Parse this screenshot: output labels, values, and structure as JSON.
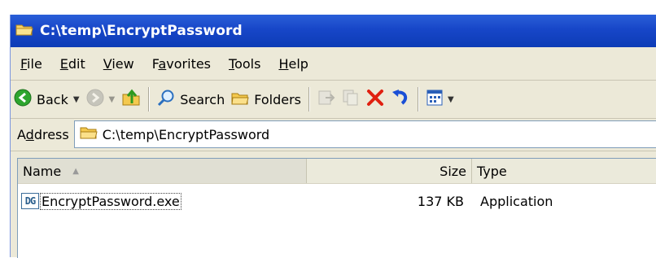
{
  "window": {
    "title": "C:\\temp\\EncryptPassword"
  },
  "menubar": {
    "items": [
      {
        "pre": "",
        "u": "F",
        "post": "ile"
      },
      {
        "pre": "",
        "u": "E",
        "post": "dit"
      },
      {
        "pre": "",
        "u": "V",
        "post": "iew"
      },
      {
        "pre": "F",
        "u": "a",
        "post": "vorites"
      },
      {
        "pre": "",
        "u": "T",
        "post": "ools"
      },
      {
        "pre": "",
        "u": "H",
        "post": "elp"
      }
    ]
  },
  "toolbar": {
    "back_label": "Back",
    "search_label": "Search",
    "folders_label": "Folders"
  },
  "address": {
    "label_pre": "A",
    "label_u": "d",
    "label_post": "dress",
    "value": "C:\\temp\\EncryptPassword"
  },
  "list": {
    "columns": {
      "name": "Name",
      "size": "Size",
      "type": "Type"
    },
    "rows": [
      {
        "icon": "DG",
        "name": "EncryptPassword.exe",
        "size": "137 KB",
        "type": "Application"
      }
    ]
  },
  "colors": {
    "titlebar": "#1746c8",
    "chrome": "#ece9d8",
    "delete_red": "#e02010",
    "undo_blue": "#1a4fd6"
  }
}
